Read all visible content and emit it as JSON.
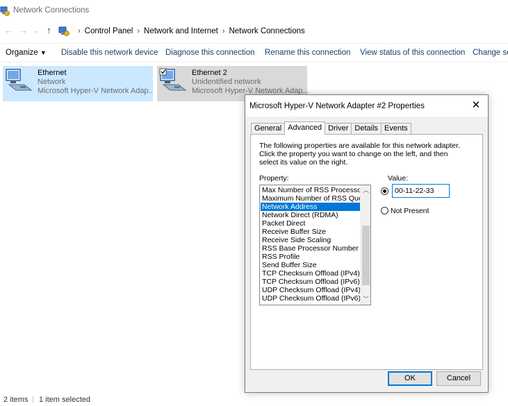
{
  "window": {
    "title": "Network Connections"
  },
  "address": {
    "crumbs": [
      "Control Panel",
      "Network and Internet",
      "Network Connections"
    ]
  },
  "commands": {
    "organize": "Organize",
    "disable": "Disable this network device",
    "diagnose": "Diagnose this connection",
    "rename": "Rename this connection",
    "view_status": "View status of this connection",
    "change_settings": "Change set"
  },
  "adapters": [
    {
      "name": "Ethernet",
      "status": "Network",
      "device": "Microsoft Hyper-V Network Adap..."
    },
    {
      "name": "Ethernet 2",
      "status": "Unidentified network",
      "device": "Microsoft Hyper-V Network Adap..."
    }
  ],
  "statusbar": {
    "items": "2 items",
    "selected": "1 item selected"
  },
  "dialog": {
    "title": "Microsoft Hyper-V Network Adapter #2 Properties",
    "tabs": [
      "General",
      "Advanced",
      "Driver",
      "Details",
      "Events"
    ],
    "active_tab": "Advanced",
    "description": "The following properties are available for this network adapter. Click the property you want to change on the left, and then select its value on the right.",
    "property_label": "Property:",
    "value_label": "Value:",
    "properties": [
      "Max Number of RSS Processors",
      "Maximum Number of RSS Queues",
      "Network Address",
      "Network Direct (RDMA)",
      "Packet Direct",
      "Receive Buffer Size",
      "Receive Side Scaling",
      "RSS Base Processor Number",
      "RSS Profile",
      "Send Buffer Size",
      "TCP Checksum Offload (IPv4)",
      "TCP Checksum Offload (IPv6)",
      "UDP Checksum Offload (IPv4)",
      "UDP Checksum Offload (IPv6)"
    ],
    "selected_property": "Network Address",
    "value": "00-11-22-33",
    "not_present_label": "Not Present",
    "ok": "OK",
    "cancel": "Cancel"
  },
  "colors": {
    "selection": "#0078d7",
    "selected_adapter_bg": "#cce8ff",
    "link": "#1a3e6e"
  }
}
